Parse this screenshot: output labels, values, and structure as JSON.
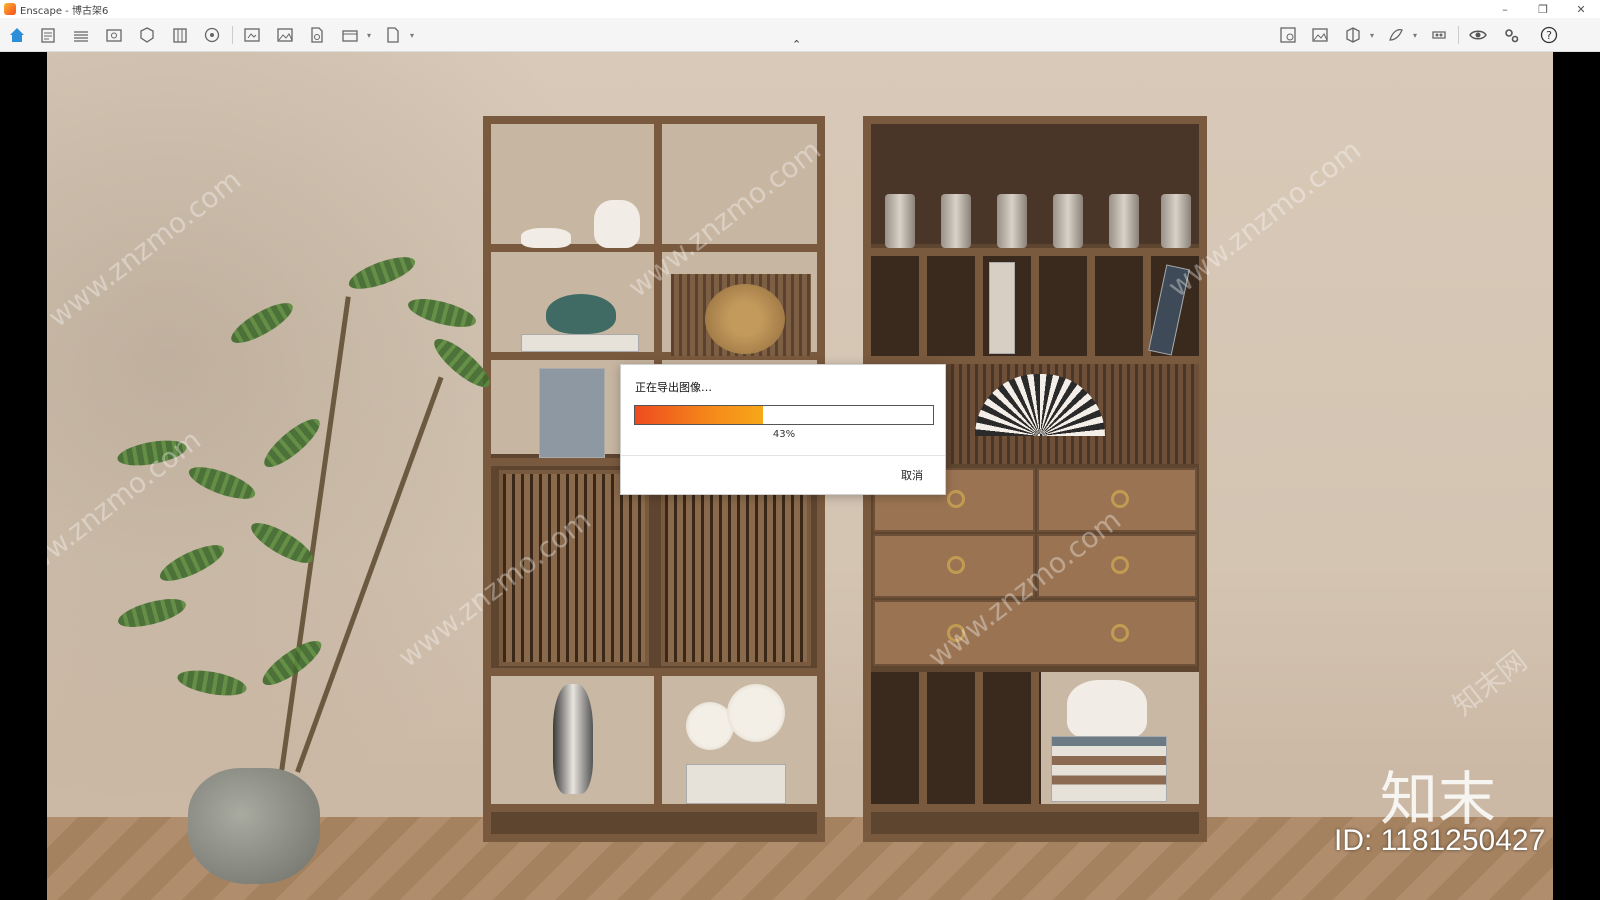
{
  "window": {
    "title": "Enscape - 博古架6",
    "minimize": "–",
    "restore": "❐",
    "close": "✕"
  },
  "toolbar": {
    "left_icons": [
      "home-icon",
      "sketch-icon",
      "bim-icon",
      "view-icon",
      "asset-icon",
      "library-icon",
      "material-icon",
      "screenshot-icon",
      "batch-render-icon",
      "export-icon",
      "video-icon",
      "panorama-icon"
    ],
    "right_icons": [
      "visual-settings-icon",
      "image-icon",
      "section-icon",
      "atlas-icon",
      "vr-icon",
      "eye-icon",
      "settings-icon",
      "help-icon"
    ],
    "collapse": "⌃",
    "help": "?"
  },
  "dialog": {
    "title": "正在导出图像…",
    "progress_label": "43%",
    "progress_value": 43,
    "cancel_label": "取消"
  },
  "watermark": {
    "brand": "知末",
    "id_text": "ID: 1181250427",
    "site": "www.znzmo.com",
    "site_cn": "知末网"
  },
  "colors": {
    "progress_start": "#ee4b1f",
    "progress_end": "#f7a719",
    "accent_home": "#2d8fd8"
  }
}
